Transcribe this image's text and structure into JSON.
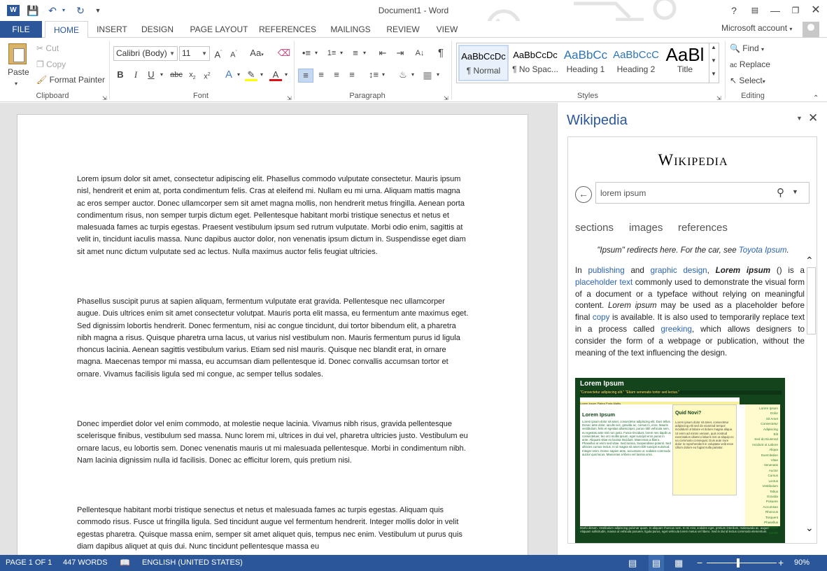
{
  "app": {
    "window_title": "Document1 - Word",
    "account_label": "Microsoft account",
    "accent_color": "#2b579a"
  },
  "tabs": [
    "FILE",
    "HOME",
    "INSERT",
    "DESIGN",
    "PAGE LAYOUT",
    "REFERENCES",
    "MAILINGS",
    "REVIEW",
    "VIEW"
  ],
  "active_tab": "HOME",
  "ribbon": {
    "clipboard": {
      "paste": "Paste",
      "cut": "Cut",
      "copy": "Copy",
      "format_painter": "Format Painter",
      "label": "Clipboard"
    },
    "font": {
      "family": "Calibri (Body)",
      "size": "11",
      "label": "Font"
    },
    "paragraph": {
      "label": "Paragraph"
    },
    "styles": {
      "label": "Styles",
      "items": [
        {
          "preview": "AaBbCcDc",
          "name": "¶ Normal"
        },
        {
          "preview": "AaBbCcDc",
          "name": "¶ No Spac..."
        },
        {
          "preview": "AaBbCc",
          "name": "Heading 1"
        },
        {
          "preview": "AaBbCcC",
          "name": "Heading 2"
        },
        {
          "preview": "AaBl",
          "name": "Title"
        }
      ]
    },
    "editing": {
      "find": "Find",
      "replace": "Replace",
      "select": "Select",
      "label": "Editing"
    }
  },
  "document": {
    "paragraphs": [
      "Lorem ipsum dolor sit amet, consectetur adipiscing elit. Phasellus commodo vulputate consectetur. Mauris ipsum nisl, hendrerit et enim at, porta condimentum felis. Cras at eleifend mi. Nullam eu mi urna. Aliquam mattis magna ac eros semper auctor. Donec ullamcorper sem sit amet magna mollis, non hendrerit metus fringilla. Aenean porta condimentum risus, non semper turpis dictum eget. Pellentesque habitant morbi tristique senectus et netus et malesuada fames ac turpis egestas. Praesent vestibulum ipsum sed rutrum vulputate. Morbi odio enim, sagittis at velit in, tincidunt iaculis massa. Nunc dapibus auctor dolor, non venenatis ipsum dictum in. Suspendisse eget diam sit amet nunc dictum vulputate sed ac lectus. Nulla maximus auctor felis feugiat ultricies.",
      "Phasellus suscipit purus at sapien aliquam, fermentum vulputate erat gravida. Pellentesque nec ullamcorper augue. Duis ultrices enim sit amet consectetur volutpat. Mauris porta elit massa, eu fermentum ante maximus eget. Sed dignissim lobortis hendrerit. Donec fermentum, nisi ac congue tincidunt, dui tortor bibendum elit, a pharetra nibh magna a risus. Quisque pharetra urna lacus, ut varius nisl vestibulum non. Mauris fermentum purus id ligula rhoncus lacinia. Aenean sagittis vestibulum varius. Etiam sed nisl mauris. Quisque nec blandit erat, in ornare magna. Maecenas tempor mi massa, eu accumsan diam pellentesque id. Donec convallis accumsan tortor et ornare. Vivamus facilisis ligula sed mi congue, ac semper tellus sodales.",
      "Donec imperdiet dolor vel enim commodo, at molestie neque lacinia. Vivamus nibh risus, gravida pellentesque scelerisque finibus, vestibulum sed massa. Nunc lorem mi, ultrices in dui vel, pharetra ultricies justo. Vestibulum eu ornare lacus, eu lobortis sem. Donec venenatis mauris ut mi malesuada pellentesque. Morbi in condimentum nibh. Nam lacinia dignissim nulla id facilisis. Donec ac efficitur lorem, quis pretium nisi.",
      "Pellentesque habitant morbi tristique senectus et netus et malesuada fames ac turpis egestas. Aliquam quis commodo risus. Fusce ut fringilla ligula. Sed tincidunt augue vel fermentum hendrerit. Integer mollis dolor in velit egestas pharetra. Quisque massa enim, semper sit amet aliquet quis, tempus nec enim. Vestibulum ut purus quis diam dapibus aliquet at quis dui. Nunc tincidunt pellentesque massa eu"
    ]
  },
  "pane": {
    "title": "Wikipedia",
    "logo_text": "Wikipedia",
    "search_value": "lorem ipsum",
    "tabs": [
      "sections",
      "images",
      "references"
    ],
    "redirect_prefix": "\"Ipsum\" redirects here. For the car, see ",
    "redirect_link": "Toyota Ipsum",
    "redirect_suffix": ".",
    "article": {
      "t1": "In ",
      "l1": "publishing",
      "t2": " and ",
      "l2": "graphic design",
      "t3": ", ",
      "b1": "Lorem ipsum",
      "t4": " () is a ",
      "l3": "placeholder text",
      "t5": " commonly used to demonstrate the visual form of a document or a typeface without relying on meaningful content. ",
      "i1": "Lorem ipsum",
      "t6": " may be used as a placeholder before final ",
      "l4": "copy",
      "t7": " is available. It is also used to temporarily replace text in a process called ",
      "l5": "greeking",
      "t8": ", which allows designers to consider the form of a webpage or publication, without the meaning of the text influencing the design."
    },
    "thumb": {
      "title": "Lorem Ipsum",
      "subtitle": "\"Consectetur adipiscing elit.\" \"Etiam venenatis tortor sed lectus.\"",
      "nav": "Lorem Ipsum  Platea  Porta  Mattis",
      "heading": "Lorem Ipsum",
      "box_heading": "Quid Novi?",
      "body": "Lorem ipsum dolor sit amet, consectetur adipiscing elit. Duis tellus. Donec ante dolor, iaculis nec, gravida ac, cursus in, eros. Mauris vestibulum, felis et egestas ullamcorper, purus nibh vehicula sem, eu egestas ante nisl non justo. Fusce tincidunt, lorem nev dapib us consectetuer, leo orci mollis ipsum, eget suscipit eros purus in ante. Aliquam vitae ex lacinia tincidunt. Maecenas a libero. Phasellus ut enim sed vitae. Sed lacinia, Suspendisse potenti. Sed ultricies cursus lectus. In id magna sit amet nibh suscipit euismod. Integer enim. Donec sapien ante, accumsan ut, sodales commodo auctor quis lacus. Maecenas a libero vel lacinia urna.",
      "box_body": "Lorem ipsum dolor sit amet, consectetur adipiscing elit sed do eiusmod tempor incididunt ut labore et dolore magna aliqua. Ut enim ad minim veniam, quis nostrud exercitation ullamco laboris nisi ut aliquip ex ea commodo consequat. Duis aute irure dolor in reprehenderit in voluptate velit esse cillum dolore eu fugiat nulla pariatur.",
      "side": [
        "Lorem Ipsum",
        "Dolor",
        "Sit Amet",
        "Consectetur",
        "Adipiscing",
        "Elit",
        "Sed do Eiusmod",
        "Incidunt ut Labore",
        "Aliqua",
        "Exercitation",
        "Vitae",
        "Venenatis",
        "Auctor",
        "Cursus",
        "Lectus",
        "Vestibulum",
        "Tellus",
        "Gravida",
        "Posuere",
        "Accumsan",
        "Rhoncus",
        "Torquent",
        "Phasellus",
        "Tempor",
        "Auctor"
      ],
      "foot": "Morbi dictum. Vestibulum adipiscing pulvinar quam. In aliquam rhoncus sem. In mi erat, sodales eget, pretium interdum, malesuada ac, augue. Aliquam sollicitudin, massa ut vehicula posuere, ligula purus, eget vehicula lorem metus vel libero. Sed in dui id lectus commodo elementum."
    }
  },
  "status": {
    "page": "PAGE 1 OF 1",
    "words": "447 WORDS",
    "language": "ENGLISH (UNITED STATES)",
    "zoom": "90%",
    "zoom_value": 0.45
  }
}
